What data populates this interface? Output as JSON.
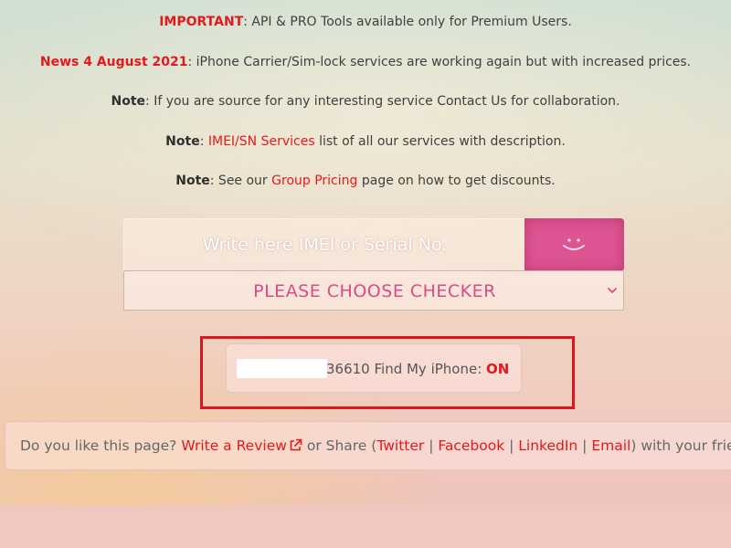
{
  "notices": {
    "important": {
      "tag": "IMPORTANT",
      "text": ": API & PRO Tools available only for Premium Users."
    },
    "news": {
      "tag": "News 4 August 2021",
      "text": ": iPhone Carrier/Sim-lock services are working again but with increased prices."
    },
    "note1": {
      "tag": "Note",
      "text": ": If you are source for any interesting service Contact Us for collaboration."
    },
    "note2": {
      "tag": "Note",
      "sep": ": ",
      "link": "IMEI/SN Services",
      "text": " list of all our services with description."
    },
    "note3": {
      "tag": "Note",
      "pre": ": See our ",
      "link": "Group Pricing",
      "text": " page on how to get discounts."
    }
  },
  "search": {
    "placeholder": "Write here IMEI or Serial No.",
    "submit_icon": "smiley-icon"
  },
  "checker": {
    "selected": "PLEASE CHOOSE CHECKER",
    "icon": "chevron-down-icon"
  },
  "result": {
    "imei_suffix": "36610",
    "label": " Find My iPhone: ",
    "status": "ON"
  },
  "share": {
    "question": "Do you like this page? ",
    "review": "Write a Review",
    "or_share": " or Share (",
    "twitter": "Twitter",
    "sep": " | ",
    "facebook": "Facebook",
    "linkedin": "LinkedIn",
    "email": "Email",
    "suffix": ") with your friends."
  },
  "colors": {
    "accent_red": "#e3191d",
    "button_pink": "#dc5592",
    "checker_pink": "#d84d84"
  }
}
